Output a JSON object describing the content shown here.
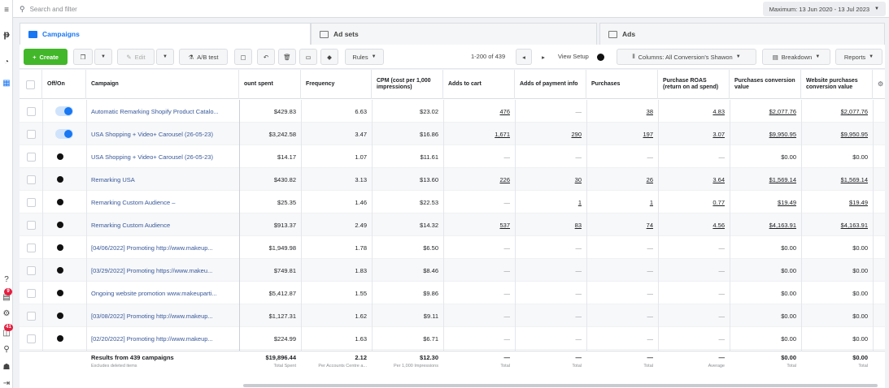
{
  "search": {
    "placeholder": "Search and filter"
  },
  "date_range": "Maximum: 13 Jun 2020 - 13 Jul 2023",
  "tabs": [
    {
      "label": "Campaigns"
    },
    {
      "label": "Ad sets"
    },
    {
      "label": "Ads"
    }
  ],
  "toolbar": {
    "create": "Create",
    "edit": "Edit",
    "ab_test": "A/B test",
    "rules": "Rules",
    "pager": "1-200 of 439",
    "view_setup": "View Setup",
    "columns": "Columns: All Conversion's Shawon",
    "breakdown": "Breakdown",
    "reports": "Reports"
  },
  "rail": {
    "badge1": "9",
    "badge2": "41"
  },
  "columns": {
    "onoff": "Off/On",
    "campaign": "Campaign",
    "spent": "ount spent",
    "frequency": "Frequency",
    "cpm": "CPM (cost per 1,000 impressions)",
    "adds_to_cart": "Adds to cart",
    "adds_payment": "Adds of payment info",
    "purchases": "Purchases",
    "roas": "Purchase ROAS (return on ad spend)",
    "conv_value": "Purchases conversion value",
    "web_conv_value": "Website purchases conversion value"
  },
  "rows": [
    {
      "on": true,
      "campaign": "Automatic Remarking Shopify Product Catalo...",
      "spent": "$429.83",
      "freq": "6.63",
      "cpm": "$23.02",
      "atc": "476",
      "api": "—",
      "pur": "38",
      "roas": "4.83",
      "cv": "$2,077.76",
      "wcv": "$2,077.76"
    },
    {
      "on": true,
      "campaign": "USA Shopping + Video+ Carousel (26-05-23)",
      "spent": "$3,242.58",
      "freq": "3.47",
      "cpm": "$16.86",
      "atc": "1,671",
      "api": "290",
      "pur": "197",
      "roas": "3.07",
      "cv": "$9,950.95",
      "wcv": "$9,950.95"
    },
    {
      "on": false,
      "campaign": "USA Shopping + Video+ Carousel (26-05-23)",
      "spent": "$14.17",
      "freq": "1.07",
      "cpm": "$11.61",
      "atc": "—",
      "api": "—",
      "pur": "—",
      "roas": "—",
      "cv": "$0.00",
      "wcv": "$0.00"
    },
    {
      "on": false,
      "campaign": "Remarking USA",
      "spent": "$430.82",
      "freq": "3.13",
      "cpm": "$13.60",
      "atc": "226",
      "api": "30",
      "pur": "26",
      "roas": "3.64",
      "cv": "$1,569.14",
      "wcv": "$1,569.14"
    },
    {
      "on": false,
      "campaign": "Remarking Custom Audience –",
      "spent": "$25.35",
      "freq": "1.46",
      "cpm": "$22.53",
      "atc": "—",
      "api": "1",
      "pur": "1",
      "roas": "0.77",
      "cv": "$19.49",
      "wcv": "$19.49"
    },
    {
      "on": false,
      "campaign": "Remarking Custom Audience",
      "spent": "$913.37",
      "freq": "2.49",
      "cpm": "$14.32",
      "atc": "537",
      "api": "83",
      "pur": "74",
      "roas": "4.56",
      "cv": "$4,163.91",
      "wcv": "$4,163.91"
    },
    {
      "on": false,
      "campaign": "[04/06/2022] Promoting http://www.makeup...",
      "spent": "$1,949.98",
      "freq": "1.78",
      "cpm": "$6.50",
      "atc": "—",
      "api": "—",
      "pur": "—",
      "roas": "—",
      "cv": "$0.00",
      "wcv": "$0.00"
    },
    {
      "on": false,
      "campaign": "[03/29/2022] Promoting https://www.makeu...",
      "spent": "$749.81",
      "freq": "1.83",
      "cpm": "$8.46",
      "atc": "—",
      "api": "—",
      "pur": "—",
      "roas": "—",
      "cv": "$0.00",
      "wcv": "$0.00"
    },
    {
      "on": false,
      "campaign": "Ongoing website promotion www.makeuparti...",
      "spent": "$5,412.87",
      "freq": "1.55",
      "cpm": "$9.86",
      "atc": "—",
      "api": "—",
      "pur": "—",
      "roas": "—",
      "cv": "$0.00",
      "wcv": "$0.00"
    },
    {
      "on": false,
      "campaign": "[03/08/2022] Promoting http://www.makeup...",
      "spent": "$1,127.31",
      "freq": "1.62",
      "cpm": "$9.11",
      "atc": "—",
      "api": "—",
      "pur": "—",
      "roas": "—",
      "cv": "$0.00",
      "wcv": "$0.00"
    },
    {
      "on": false,
      "campaign": "[02/20/2022] Promoting http://www.makeup...",
      "spent": "$224.99",
      "freq": "1.63",
      "cpm": "$6.71",
      "atc": "—",
      "api": "—",
      "pur": "—",
      "roas": "—",
      "cv": "$0.00",
      "wcv": "$0.00"
    }
  ],
  "footer": {
    "title": "Results from 439 campaigns",
    "sub": "Excludes deleted items",
    "spent": "$19,896.44",
    "spent_sub": "Total Spent",
    "freq": "2.12",
    "freq_sub": "Per Accounts Centre a...",
    "cpm": "$12.30",
    "cpm_sub": "Per 1,000 Impressions",
    "atc": "—",
    "atc_sub": "Total",
    "api": "—",
    "api_sub": "Total",
    "pur": "—",
    "pur_sub": "Total",
    "roas": "—",
    "roas_sub": "Average",
    "cv": "$0.00",
    "cv_sub": "Total",
    "wcv": "$0.00",
    "wcv_sub": "Total"
  }
}
